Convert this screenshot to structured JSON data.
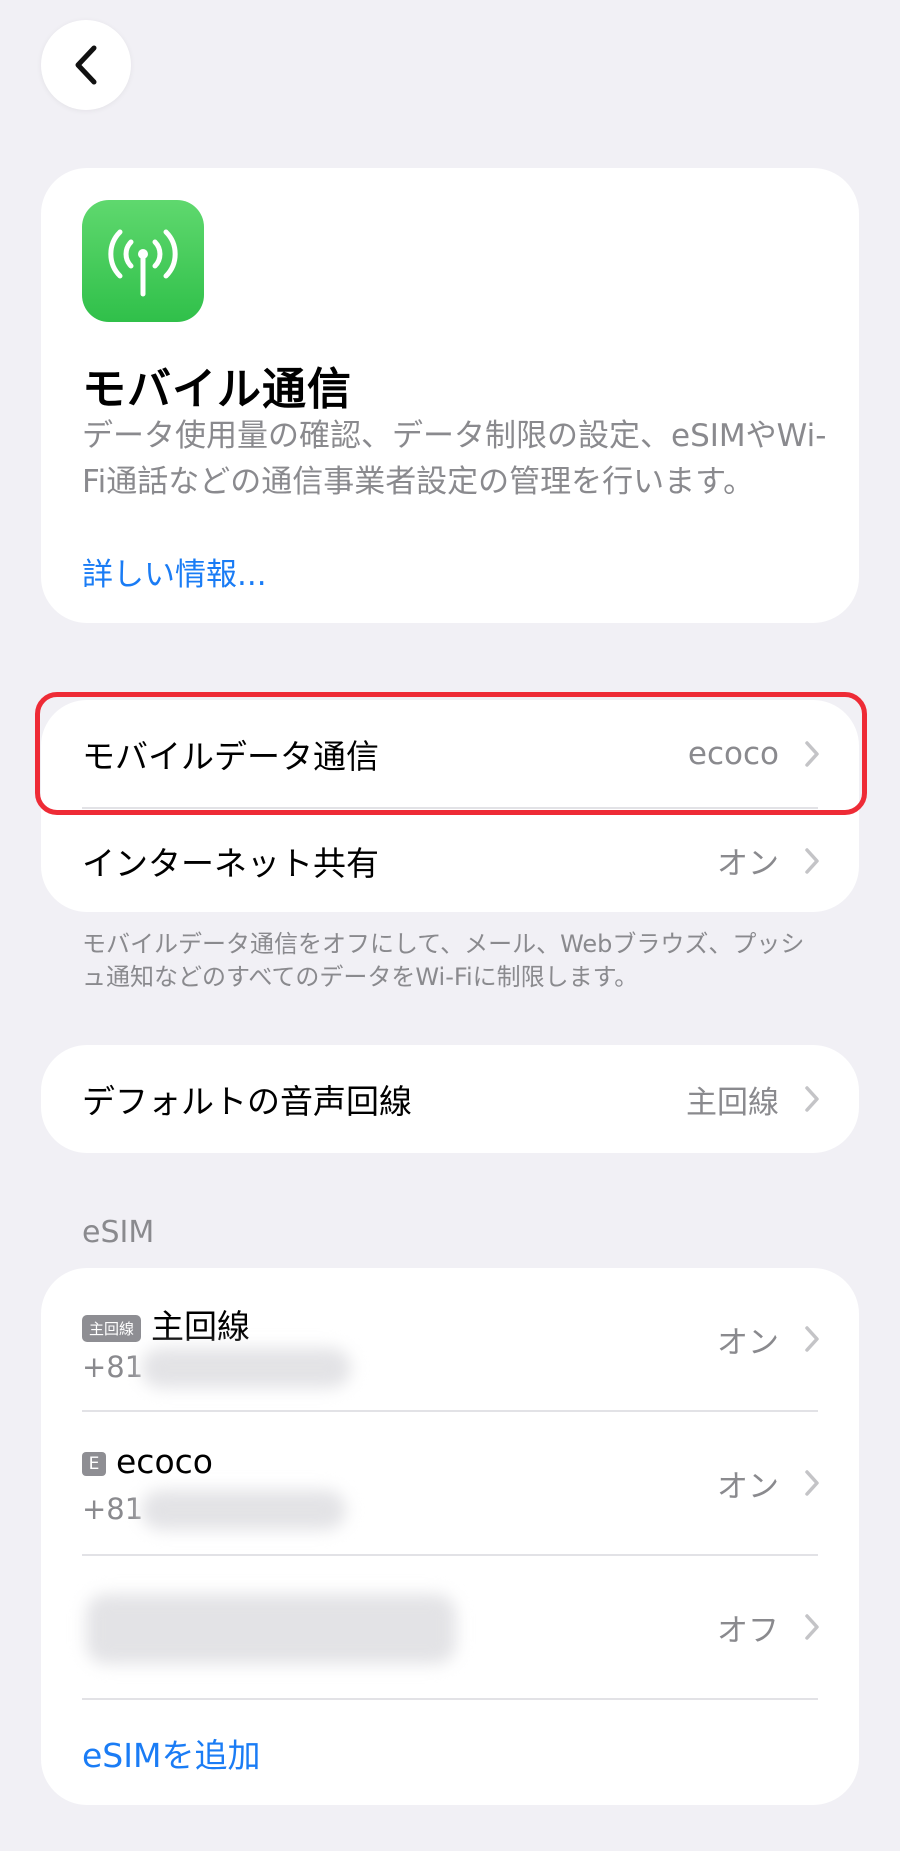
{
  "nav": {
    "back_icon": "chevron-left-icon"
  },
  "header": {
    "icon": "antenna-icon",
    "title": "モバイル通信",
    "description": "データ使用量の確認、データ制限の設定、eSIMやWi-Fi通話などの通信事業者設定の管理を行います。",
    "more_link": "詳しい情報..."
  },
  "group1": {
    "rows": [
      {
        "label": "モバイルデータ通信",
        "value": "ecoco"
      },
      {
        "label": "インターネット共有",
        "value": "オン"
      }
    ],
    "footnote": "モバイルデータ通信をオフにして、メール、Webブラウズ、プッシュ通知などのすべてのデータをWi-Fiに制限します。"
  },
  "group2": {
    "rows": [
      {
        "label": "デフォルトの音声回線",
        "value": "主回線"
      }
    ]
  },
  "esim": {
    "section_title": "eSIM",
    "lines": [
      {
        "badge": "主回線",
        "name": "主回線",
        "number_prefix": "+81",
        "status": "オン"
      },
      {
        "badge": "E",
        "name": "ecoco",
        "number_prefix": "+81",
        "status": "オン"
      },
      {
        "status": "オフ"
      }
    ],
    "add_link": "eSIMを追加"
  },
  "colors": {
    "background": "#f1f0f5",
    "accent": "#1a7cf5",
    "highlight": "#ee2b36",
    "icon_green": "#34c759"
  }
}
